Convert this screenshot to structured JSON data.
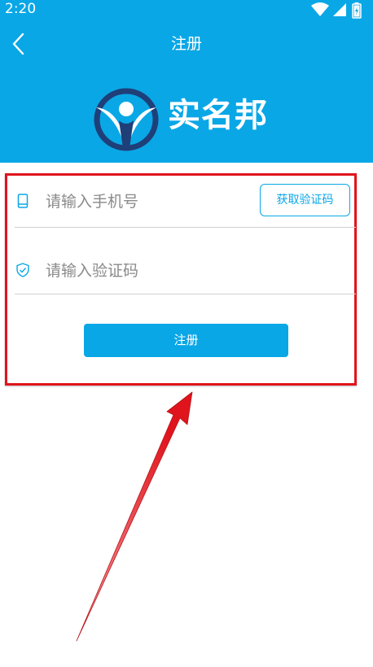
{
  "status_bar": {
    "time": "2:20",
    "icons": [
      "wifi-icon",
      "signal-icon",
      "battery-icon"
    ]
  },
  "header": {
    "back_icon": "chevron-left-icon",
    "title": "注册",
    "logo_text": "实名邦"
  },
  "form": {
    "phone": {
      "icon": "phone-icon",
      "placeholder": "请输入手机号",
      "value": ""
    },
    "get_code_label": "获取验证码",
    "code": {
      "icon": "shield-icon",
      "placeholder": "请输入验证码",
      "value": ""
    },
    "submit_label": "注册"
  },
  "colors": {
    "primary": "#0aa7e6",
    "annotation_red": "#e0141c",
    "logo_dark": "#1f3f78"
  }
}
